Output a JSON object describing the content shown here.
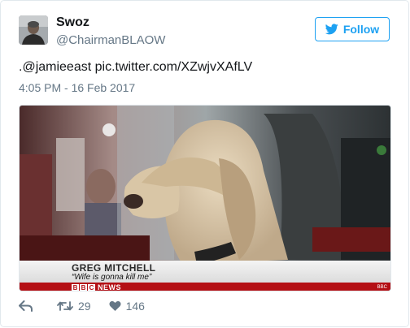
{
  "user": {
    "display_name": "Swoz",
    "handle": "@ChairmanBLAOW"
  },
  "follow_button": {
    "label": "Follow",
    "icon": "twitter-bird-icon"
  },
  "tweet": {
    "mention": ".@jamieeast",
    "link": "pic.twitter.com/XZwjvXAfLV",
    "timestamp": "4:05 PM - 16 Feb 2017"
  },
  "media": {
    "lower_third": {
      "name": "GREG MITCHELL",
      "caption": "“Wife is gonna kill me”",
      "bbc_letters": [
        "B",
        "B",
        "C"
      ],
      "news_label": "NEWS",
      "corner_logo": "BBC"
    }
  },
  "actions": {
    "reply_icon": "reply-icon",
    "retweet_count": "29",
    "retweet_icon": "retweet-icon",
    "like_count": "146",
    "like_icon": "heart-icon"
  },
  "colors": {
    "brand_blue": "#1da1f2",
    "muted_text": "#657786",
    "bbc_red": "#b40f14"
  }
}
